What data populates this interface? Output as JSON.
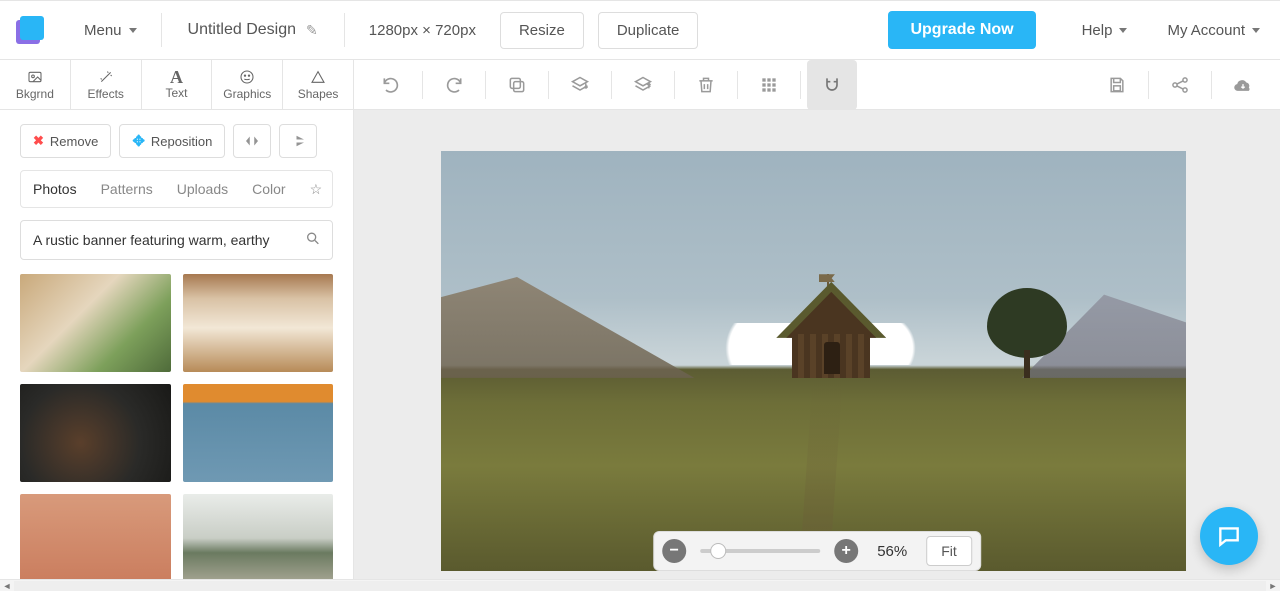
{
  "header": {
    "menu_label": "Menu",
    "title": "Untitled Design",
    "dimensions": "1280px × 720px",
    "resize_label": "Resize",
    "duplicate_label": "Duplicate",
    "upgrade_label": "Upgrade Now",
    "help_label": "Help",
    "account_label": "My Account"
  },
  "left_tabs": {
    "bkgrnd": "Bkgrnd",
    "effects": "Effects",
    "text": "Text",
    "graphics": "Graphics",
    "shapes": "Shapes"
  },
  "side": {
    "remove_label": "Remove",
    "reposition_label": "Reposition",
    "tabs": {
      "photos": "Photos",
      "patterns": "Patterns",
      "uploads": "Uploads",
      "color": "Color"
    },
    "search_value": "A rustic banner featuring warm, earthy"
  },
  "zoom": {
    "percent": "56%",
    "fit_label": "Fit"
  }
}
